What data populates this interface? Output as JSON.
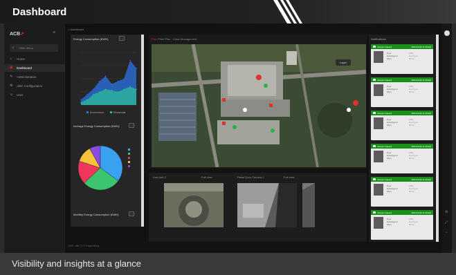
{
  "banner": {
    "title": "Dashboard",
    "caption": "Visibility and insights at a glance"
  },
  "app": {
    "logo_text": "ACB",
    "search_placeholder": "Filter Menu",
    "breadcrumb": "Dashboard",
    "sidebar": {
      "items": [
        {
          "label": "Home",
          "icon": "home-icon"
        },
        {
          "label": "Dashboard",
          "icon": "dashboard-icon",
          "active": true
        },
        {
          "label": "Administration",
          "icon": "wrench-icon"
        },
        {
          "label": "ABC Configuration",
          "icon": "gear-icon"
        },
        {
          "label": "User",
          "icon": "user-icon"
        }
      ]
    },
    "widgets": {
      "energy_title": "Energy Consumption (KWH)",
      "avg_title": "Average Energy Consumption (KWH)",
      "monthly_title": "Monthly Energy Consumption (KWH)"
    },
    "map": {
      "header_left": "Plan",
      "header_text": "Plant Plan · Class Management",
      "layer_button": "Layer"
    },
    "cameras": [
      {
        "label": "Unit Unit 2",
        "full_label": "Full view"
      },
      {
        "label": "Retail Door Camera 1",
        "full_label": "Full view"
      }
    ],
    "notifications": {
      "title": "Notifications",
      "items": [
        {
          "head": "Access Granted",
          "time": "08/12/2019 11:08 AM",
          "text": "Door\nEmployee A\nFloor",
          "sub": "ABC\nEmployee\nBlock"
        },
        {
          "head": "Access Granted",
          "time": "08/12/2019 11:08 AM",
          "text": "Door\nEmployee A\nFloor",
          "sub": "ABC\nEmployee\nBlock"
        },
        {
          "head": "Access Granted",
          "time": "08/12/2019 11:08 AM",
          "text": "Door\nEmployee A\nFloor",
          "sub": "ABC\nEmployee\nBlock"
        },
        {
          "head": "Access Granted",
          "time": "08/12/2019 11:08 AM",
          "text": "Door\nEmployee A\nFloor",
          "sub": "ABC\nEmployee\nBlock"
        },
        {
          "head": "Access Granted",
          "time": "08/12/2019 11:08 AM",
          "text": "Door\nEmployee A\nFloor",
          "sub": "ABC\nEmployee\nBlock"
        },
        {
          "head": "Access Granted",
          "time": "08/12/2019 11:08 AM",
          "text": "Door\nEmployee A\nFloor",
          "sub": "ABC\nEmployee\nBlock"
        }
      ]
    },
    "footer": "2020 · ABC E-IT Engineering",
    "colors": {
      "accent_red": "#e2231a",
      "notif_green": "#1a8f1a",
      "series_blue": "#2a6fdb",
      "series_teal": "#2bb79a"
    }
  },
  "chart_data": [
    {
      "type": "area",
      "title": "Energy Consumption (KWH)",
      "x": [
        "",
        "",
        "",
        "",
        "",
        "",
        "",
        "",
        "",
        ""
      ],
      "series": [
        {
          "name": "Environment",
          "values": [
            10,
            20,
            30,
            45,
            55,
            40,
            45,
            50,
            85,
            70
          ]
        },
        {
          "name": "Residential",
          "values": [
            5,
            10,
            20,
            25,
            30,
            28,
            25,
            30,
            35,
            30
          ]
        }
      ],
      "ylim": [
        0,
        100
      ]
    },
    {
      "type": "pie",
      "title": "Average Energy Consumption (KWH)",
      "slices": [
        {
          "label": "",
          "value": 35,
          "color": "#3aa0f0"
        },
        {
          "label": "",
          "value": 28,
          "color": "#3cc46f"
        },
        {
          "label": "",
          "value": 17,
          "color": "#f0365a"
        },
        {
          "label": "",
          "value": 12,
          "color": "#f6c33a"
        },
        {
          "label": "",
          "value": 8,
          "color": "#8a4be0"
        }
      ]
    }
  ]
}
